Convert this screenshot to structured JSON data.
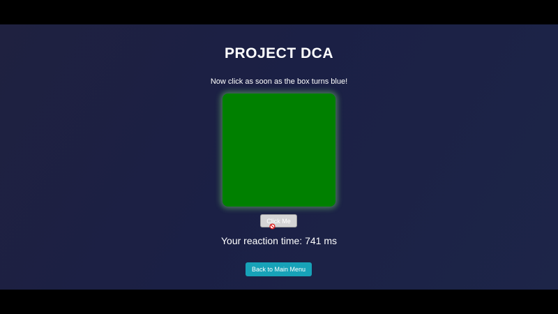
{
  "title": "PROJECT DCA",
  "instruction": "Now click as soon as the box turns blue!",
  "box": {
    "color": "#008000",
    "state": "green"
  },
  "click_button": {
    "label": "Click Me"
  },
  "cursor": {
    "icon": "not-allowed-icon"
  },
  "reaction": {
    "text": "Your reaction time: 741 ms"
  },
  "back_button": {
    "label": "Back to Main Menu",
    "color": "#17a2b8"
  }
}
